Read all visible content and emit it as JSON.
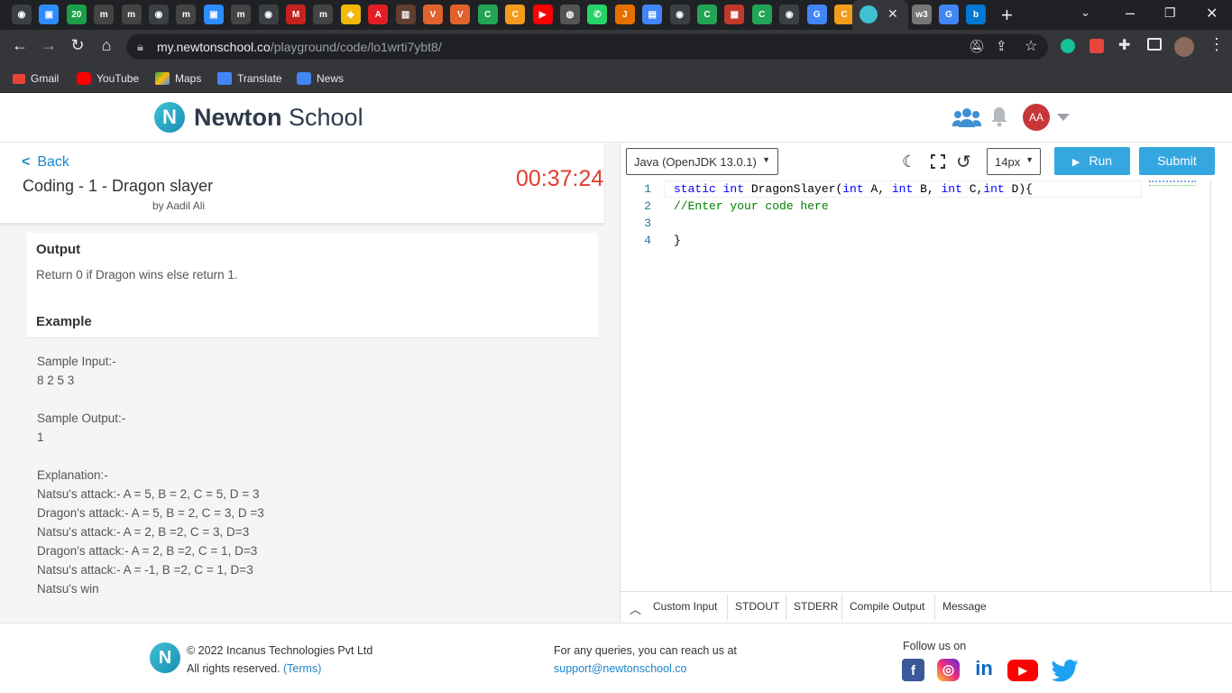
{
  "browser": {
    "url_host": "my.newtonschool.co",
    "url_path": "/playground/code/lo1wrti7ybt8/",
    "active_tab_close": "✕",
    "new_tab": "+",
    "bookmarks": [
      "Gmail",
      "YouTube",
      "Maps",
      "Translate",
      "News"
    ],
    "tab_icons": [
      {
        "label": "◉",
        "color": "#3c4043"
      },
      {
        "label": "▣",
        "color": "#2d8cff"
      },
      {
        "label": "20",
        "color": "#1a9f48"
      },
      {
        "label": "m",
        "color": "#444"
      },
      {
        "label": "m",
        "color": "#444"
      },
      {
        "label": "◉",
        "color": "#3c4043"
      },
      {
        "label": "m",
        "color": "#444"
      },
      {
        "label": "▣",
        "color": "#2d8cff"
      },
      {
        "label": "m",
        "color": "#444"
      },
      {
        "label": "◉",
        "color": "#3c4043"
      },
      {
        "label": "M",
        "color": "#c5221f"
      },
      {
        "label": "m",
        "color": "#444"
      },
      {
        "label": "◆",
        "color": "#f0b90b"
      },
      {
        "label": "A",
        "color": "#e31e25"
      },
      {
        "label": "▥",
        "color": "#5f3f2f"
      },
      {
        "label": "V",
        "color": "#e0622d"
      },
      {
        "label": "V",
        "color": "#e0622d"
      },
      {
        "label": "C",
        "color": "#23a455"
      },
      {
        "label": "C",
        "color": "#f29b1d"
      },
      {
        "label": "▶",
        "color": "#ff0000"
      },
      {
        "label": "◍",
        "color": "#555"
      },
      {
        "label": "✆",
        "color": "#25d366"
      },
      {
        "label": "J",
        "color": "#e76f00"
      },
      {
        "label": "▤",
        "color": "#4285f4"
      },
      {
        "label": "◉",
        "color": "#3c4043"
      },
      {
        "label": "C",
        "color": "#23a455"
      },
      {
        "label": "▦",
        "color": "#c0392b"
      },
      {
        "label": "C",
        "color": "#23a455"
      },
      {
        "label": "◉",
        "color": "#3c4043"
      },
      {
        "label": "G",
        "color": "#4285f4"
      },
      {
        "label": "C",
        "color": "#f29b1d"
      },
      {
        "label": "◖",
        "color": "#3ec1d3"
      }
    ],
    "tab_icons_right": [
      {
        "label": "w3",
        "color": "#777"
      },
      {
        "label": "G",
        "color": "#4285f4"
      },
      {
        "label": "b",
        "color": "#0078d4"
      }
    ]
  },
  "header": {
    "brand_bold": "Newton",
    "brand_rest": "School",
    "avatar_initials": "AA"
  },
  "problem": {
    "back_label": "Back",
    "title": "Coding - 1 - Dragon slayer",
    "author": "by Aadil Ali",
    "timer": "00:37:24",
    "output_heading": "Output",
    "output_text": "Return 0 if Dragon wins else return 1.",
    "example_heading": "Example",
    "example_lines": [
      "Sample Input:-",
      "8 2 5 3",
      "",
      "Sample Output:-",
      "1",
      "",
      "Explanation:-",
      "Natsu's attack:- A = 5, B = 2, C = 5, D = 3",
      "Dragon's attack:- A = 5, B = 2, C = 3, D =3",
      "Natsu's attack:- A = 2, B =2, C = 3, D=3",
      "Dragon's attack:- A = 2, B =2, C = 1, D=3",
      "Natsu's attack:- A = -1, B =2, C = 1, D=3",
      "Natsu's win"
    ]
  },
  "editor": {
    "language": "Java (OpenJDK 13.0.1)",
    "font_size": "14px",
    "run_label": "Run",
    "submit_label": "Submit",
    "line_numbers": [
      "1",
      "2",
      "3",
      "4"
    ],
    "code": {
      "l1_kw1": "static",
      "l1_kw2": "int",
      "l1_name": " DragonSlayer(",
      "l1_kw3": "int",
      "l1_a": " A, ",
      "l1_kw4": "int",
      "l1_b": " B, ",
      "l1_kw5": "int",
      "l1_c": " C,",
      "l1_kw6": "int",
      "l1_d": " D){",
      "l2_comment": "//Enter your code here",
      "l4": "}"
    },
    "console_tabs": [
      "Custom Input",
      "STDOUT",
      "STDERR",
      "Compile Output",
      "Message"
    ]
  },
  "footer": {
    "copyright": "© 2022 Incanus Technologies Pvt Ltd",
    "rights": "All rights reserved.",
    "terms": "(Terms)",
    "queries": "For any queries, you can reach us at",
    "email": "support@newtonschool.co",
    "follow": "Follow us on"
  },
  "colors": {
    "accent": "#34a7e0",
    "timer": "#e53b2f",
    "link": "#1b86c9"
  }
}
